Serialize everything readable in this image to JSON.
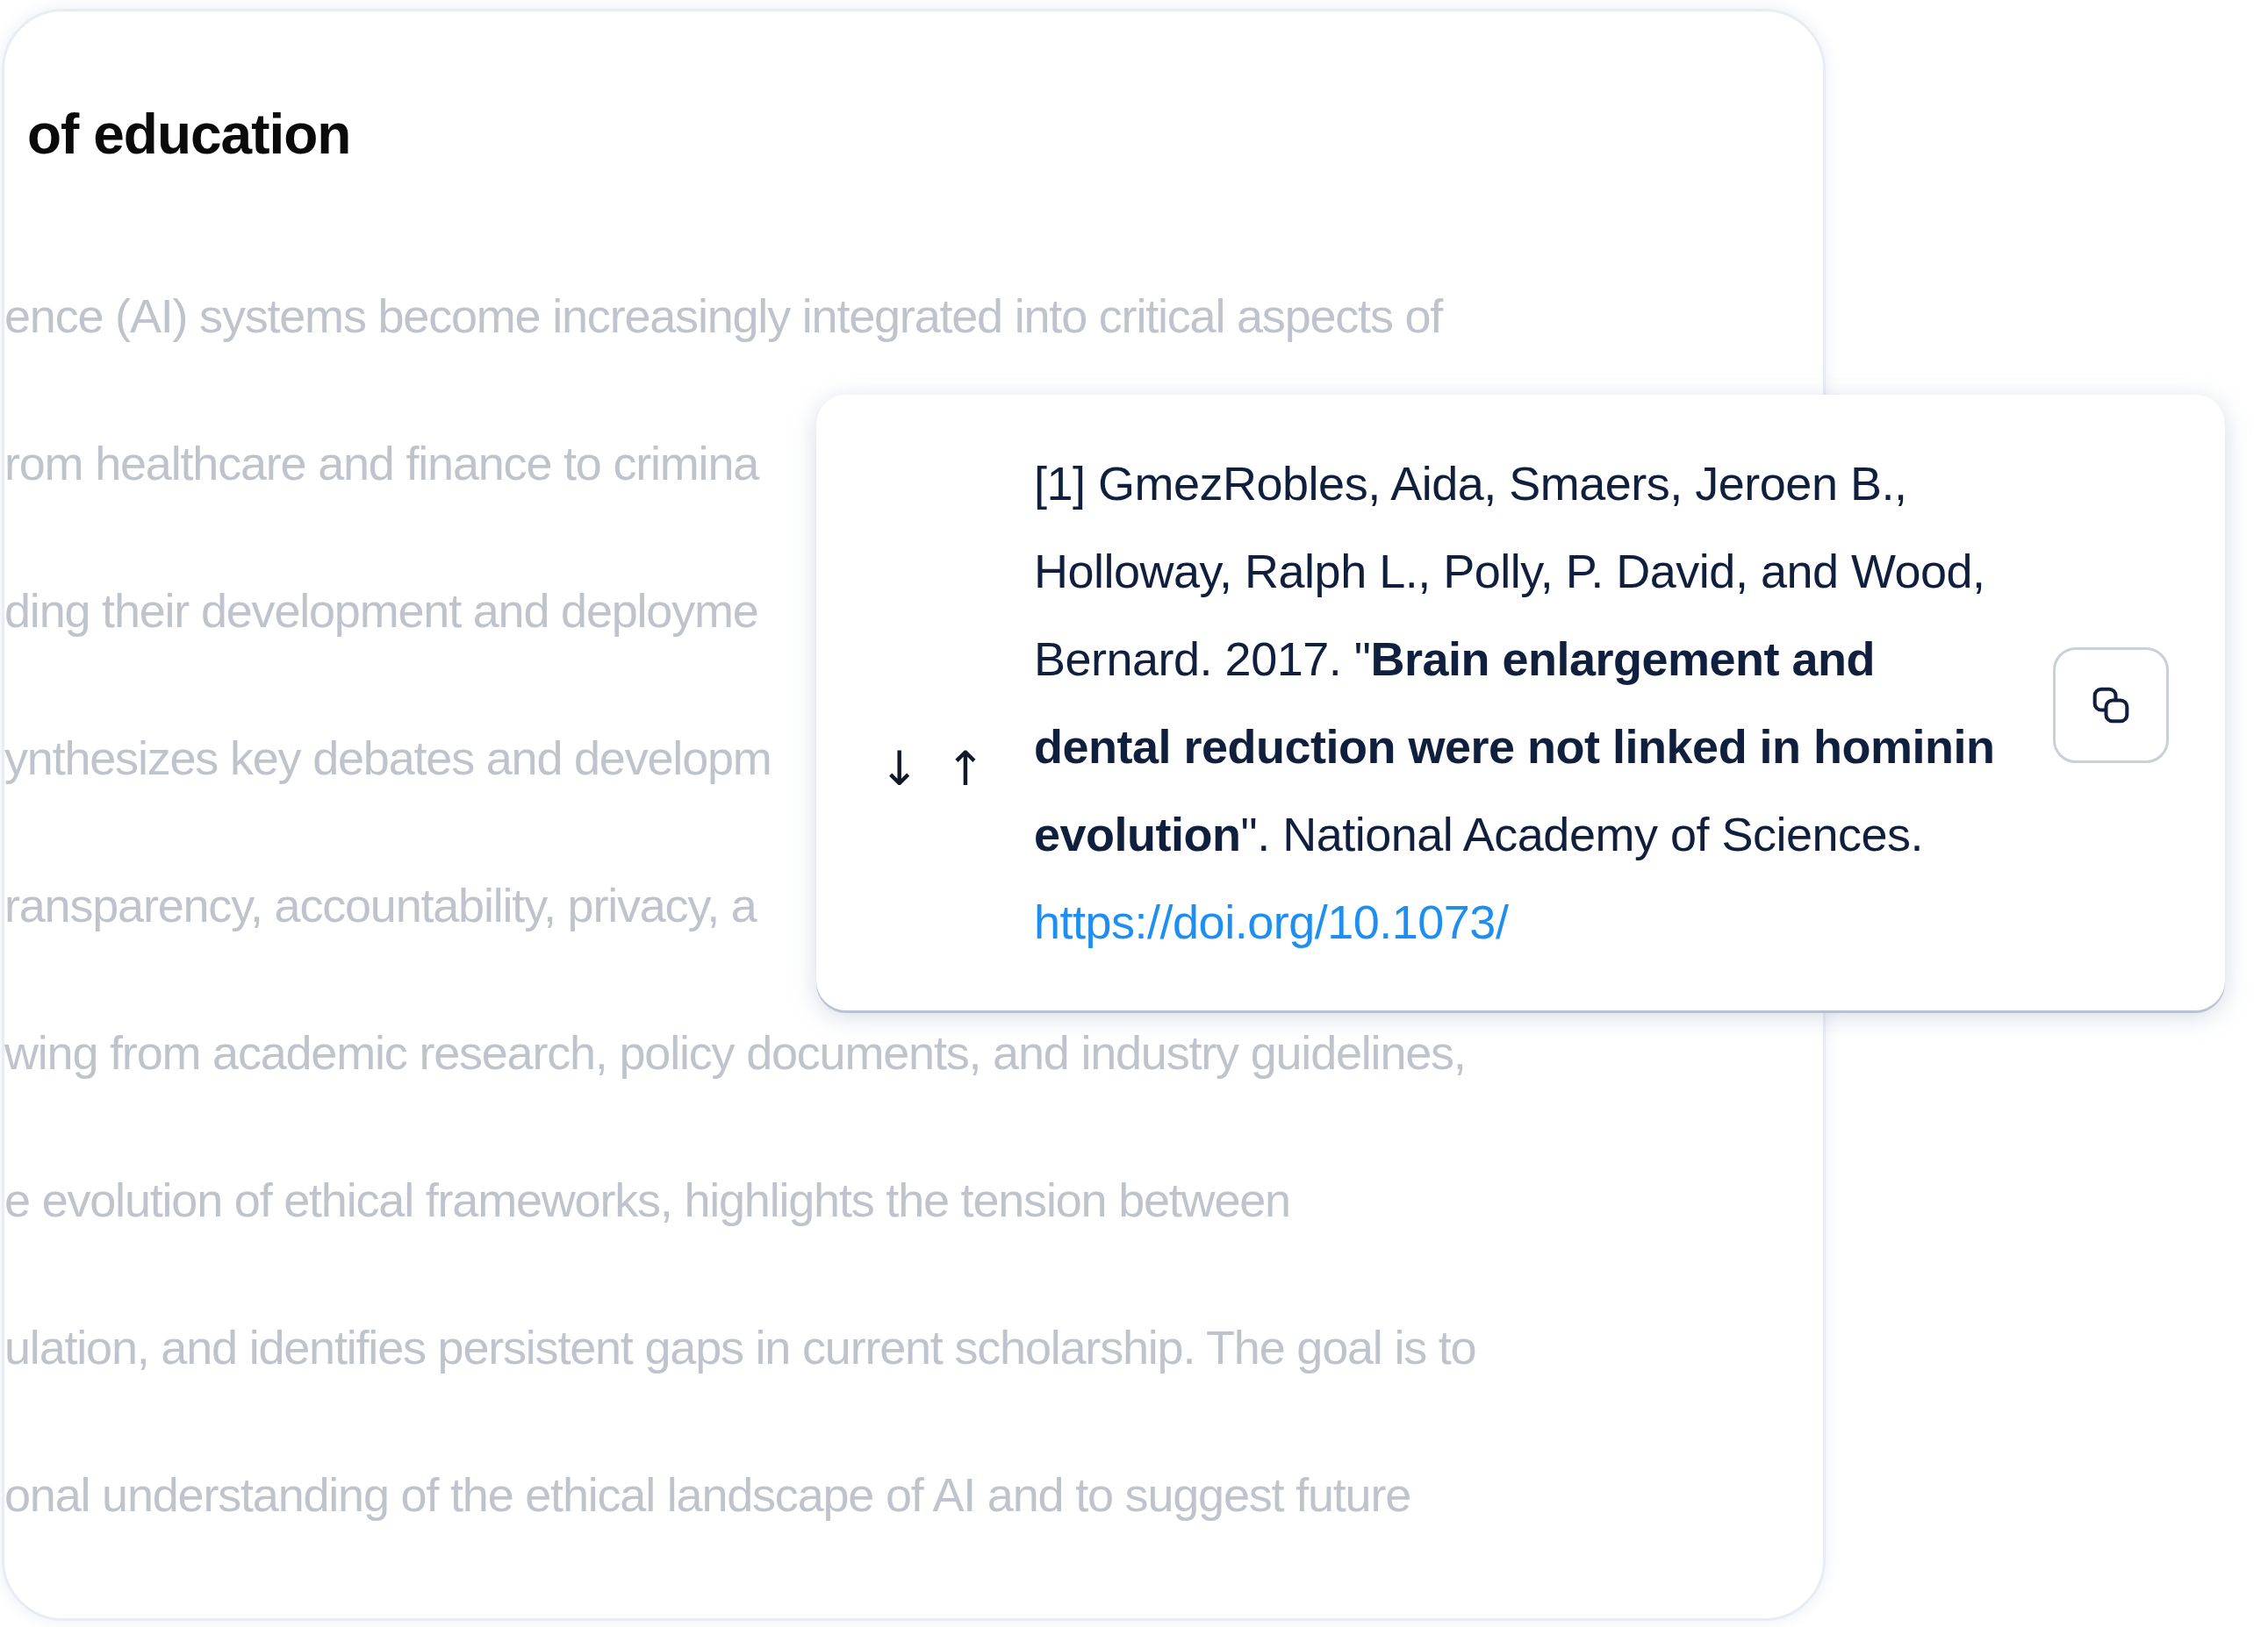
{
  "document": {
    "title": "of education",
    "lines": [
      "ence (AI) systems become increasingly integrated into critical aspects of",
      "rom healthcare and finance to crimina",
      "ding their development and deployme",
      "ynthesizes key debates and developm",
      "ransparency, accountability, privacy, a",
      "wing from academic research, policy documents, and industry guidelines,",
      "e evolution of ethical frameworks, highlights the tension between",
      "ulation, and identifies persistent gaps in current scholarship. The goal is to",
      "onal understanding of the ethical landscape of AI and to suggest future"
    ]
  },
  "citation_popup": {
    "nav_buttons": [
      "↓",
      "↑"
    ],
    "text": "[1] GmezRobles, Aida, Smaers, Jeroen B., Holloway, Ralph L., Polly, P. David, and Wood, Bernard. 2017. \"**Brain enlargement and dental reduction were not linked in hominin evolution**\". National Academy of Sciences.",
    "link": "https://doi.org/10.1073/"
  }
}
